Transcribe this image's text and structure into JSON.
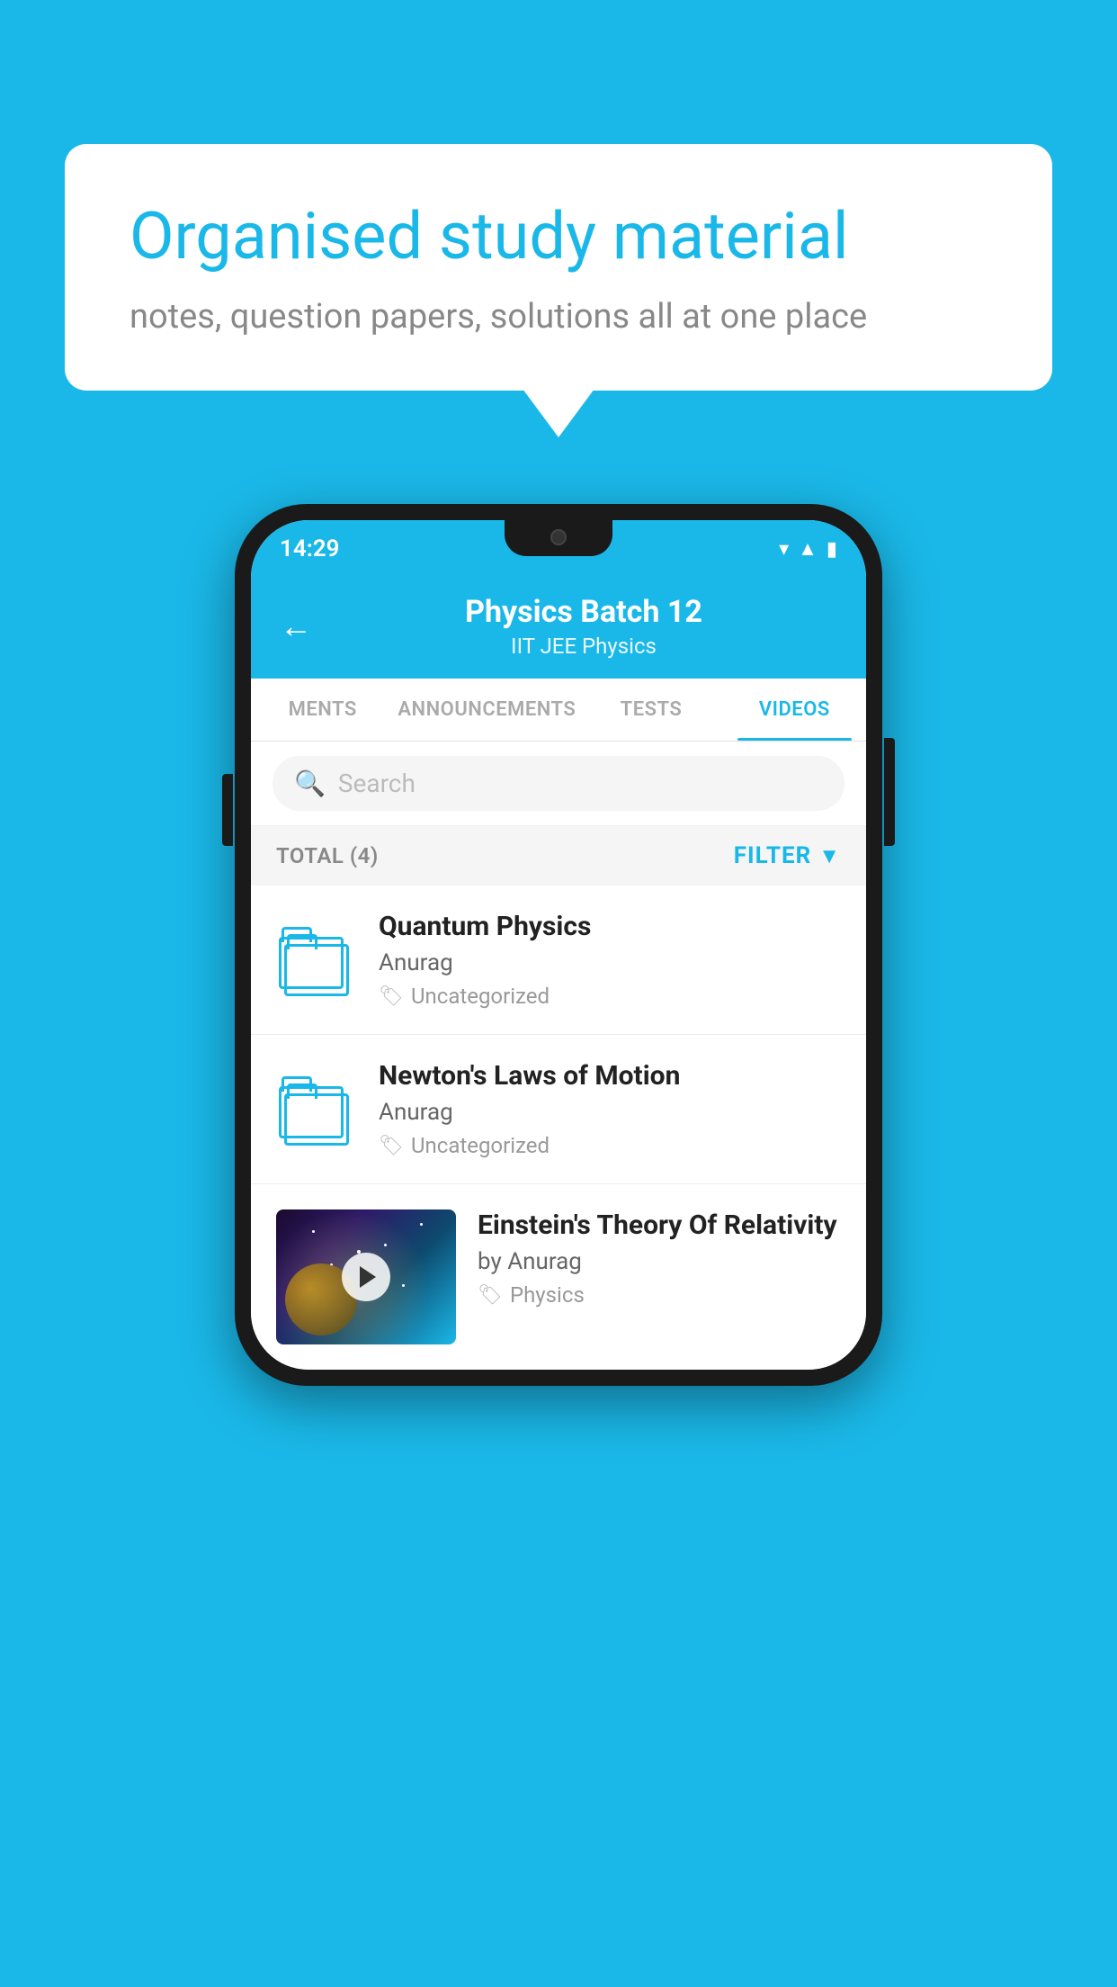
{
  "background_color": "#1ab8e8",
  "bubble": {
    "title": "Organised study material",
    "subtitle": "notes, question papers, solutions all at one place"
  },
  "phone": {
    "status_bar": {
      "time": "14:29",
      "icons": [
        "wifi",
        "signal",
        "battery"
      ]
    },
    "header": {
      "back_label": "←",
      "title": "Physics Batch 12",
      "subtitle": "IIT JEE   Physics"
    },
    "tabs": [
      {
        "label": "MENTS",
        "active": false
      },
      {
        "label": "ANNOUNCEMENTS",
        "active": false
      },
      {
        "label": "TESTS",
        "active": false
      },
      {
        "label": "VIDEOS",
        "active": true
      }
    ],
    "search": {
      "placeholder": "Search"
    },
    "filter_bar": {
      "total_label": "TOTAL (4)",
      "filter_label": "FILTER"
    },
    "videos": [
      {
        "title": "Quantum Physics",
        "author": "Anurag",
        "tag": "Uncategorized",
        "has_thumbnail": false
      },
      {
        "title": "Newton's Laws of Motion",
        "author": "Anurag",
        "tag": "Uncategorized",
        "has_thumbnail": false
      },
      {
        "title": "Einstein's Theory Of Relativity",
        "author": "by Anurag",
        "tag": "Physics",
        "has_thumbnail": true
      }
    ]
  }
}
